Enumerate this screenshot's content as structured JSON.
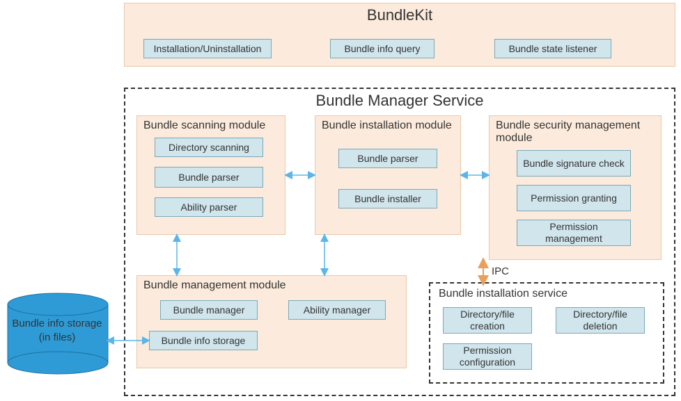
{
  "bundlekit": {
    "title": "BundleKit",
    "items": [
      "Installation/Uninstallation",
      "Bundle info query",
      "Bundle state listener"
    ]
  },
  "service": {
    "title": "Bundle Manager Service",
    "scanning": {
      "title": "Bundle scanning module",
      "items": [
        "Directory scanning",
        "Bundle parser",
        "Ability parser"
      ]
    },
    "installation": {
      "title": "Bundle installation module",
      "items": [
        "Bundle parser",
        "Bundle installer"
      ]
    },
    "security": {
      "title": "Bundle security management module",
      "items": [
        "Bundle signature check",
        "Permission granting",
        "Permission management"
      ]
    },
    "management": {
      "title": "Bundle management module",
      "items": [
        "Bundle manager",
        "Ability manager",
        "Bundle info storage"
      ]
    },
    "install_service": {
      "title": "Bundle installation service",
      "items": [
        "Directory/file creation",
        "Directory/file deletion",
        "Permission configuration"
      ]
    },
    "ipc_label": "IPC"
  },
  "storage": {
    "label": "Bundle info storage (in files)"
  }
}
